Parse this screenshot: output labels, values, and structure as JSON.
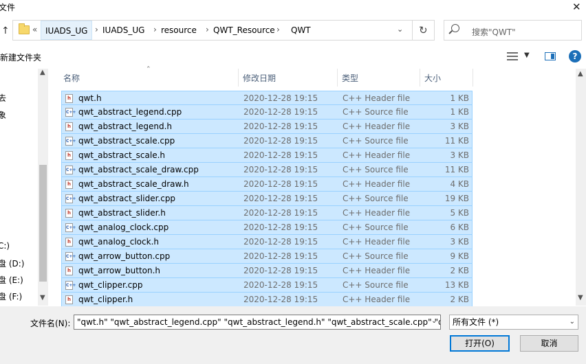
{
  "window": {
    "title": "文件"
  },
  "address": {
    "more": "«",
    "crumbs": [
      "IUADS_UG",
      "IUADS_UG",
      "resource",
      "QWT_Resource",
      "QWT"
    ],
    "separator": "›"
  },
  "search": {
    "placeholder": "搜索\"QWT\""
  },
  "toolbar": {
    "new_folder": "新建文件夹"
  },
  "nav": {
    "items": [
      {
        "label": "去"
      },
      {
        "label": "象"
      },
      {
        "label": "C:)"
      },
      {
        "label": "盘 (D:)"
      },
      {
        "label": "盘 (E:)"
      },
      {
        "label": "盘 (F:)"
      }
    ]
  },
  "columns": {
    "name": "名称",
    "date": "修改日期",
    "type": "类型",
    "size": "大小"
  },
  "files": [
    {
      "name": "qwt.h",
      "date": "2020-12-28 19:15",
      "type": "C++ Header file",
      "size": "1 KB",
      "kind": "h"
    },
    {
      "name": "qwt_abstract_legend.cpp",
      "date": "2020-12-28 19:15",
      "type": "C++ Source file",
      "size": "1 KB",
      "kind": "cpp"
    },
    {
      "name": "qwt_abstract_legend.h",
      "date": "2020-12-28 19:15",
      "type": "C++ Header file",
      "size": "3 KB",
      "kind": "h"
    },
    {
      "name": "qwt_abstract_scale.cpp",
      "date": "2020-12-28 19:15",
      "type": "C++ Source file",
      "size": "11 KB",
      "kind": "cpp"
    },
    {
      "name": "qwt_abstract_scale.h",
      "date": "2020-12-28 19:15",
      "type": "C++ Header file",
      "size": "3 KB",
      "kind": "h"
    },
    {
      "name": "qwt_abstract_scale_draw.cpp",
      "date": "2020-12-28 19:15",
      "type": "C++ Source file",
      "size": "11 KB",
      "kind": "cpp"
    },
    {
      "name": "qwt_abstract_scale_draw.h",
      "date": "2020-12-28 19:15",
      "type": "C++ Header file",
      "size": "4 KB",
      "kind": "h"
    },
    {
      "name": "qwt_abstract_slider.cpp",
      "date": "2020-12-28 19:15",
      "type": "C++ Source file",
      "size": "19 KB",
      "kind": "cpp"
    },
    {
      "name": "qwt_abstract_slider.h",
      "date": "2020-12-28 19:15",
      "type": "C++ Header file",
      "size": "5 KB",
      "kind": "h"
    },
    {
      "name": "qwt_analog_clock.cpp",
      "date": "2020-12-28 19:15",
      "type": "C++ Source file",
      "size": "6 KB",
      "kind": "cpp"
    },
    {
      "name": "qwt_analog_clock.h",
      "date": "2020-12-28 19:15",
      "type": "C++ Header file",
      "size": "3 KB",
      "kind": "h"
    },
    {
      "name": "qwt_arrow_button.cpp",
      "date": "2020-12-28 19:15",
      "type": "C++ Source file",
      "size": "9 KB",
      "kind": "cpp"
    },
    {
      "name": "qwt_arrow_button.h",
      "date": "2020-12-28 19:15",
      "type": "C++ Header file",
      "size": "2 KB",
      "kind": "h"
    },
    {
      "name": "qwt_clipper.cpp",
      "date": "2020-12-28 19:15",
      "type": "C++ Source file",
      "size": "13 KB",
      "kind": "cpp"
    },
    {
      "name": "qwt_clipper.h",
      "date": "2020-12-28 19:15",
      "type": "C++ Header file",
      "size": "2 KB",
      "kind": "h"
    }
  ],
  "icons": {
    "h": "h",
    "cpp": "C++"
  },
  "bottom": {
    "filename_label": "文件名(N):",
    "filename_value": "\"qwt.h\" \"qwt_abstract_legend.cpp\" \"qwt_abstract_legend.h\" \"qwt_abstract_scale.cpp\" \"qw",
    "filter": "所有文件 (*)",
    "open_label": "打开(O)",
    "cancel_label": "取消"
  },
  "colors": {
    "selection": "#cce8ff",
    "selection_border": "#99d1ff",
    "accent": "#0078d7"
  }
}
